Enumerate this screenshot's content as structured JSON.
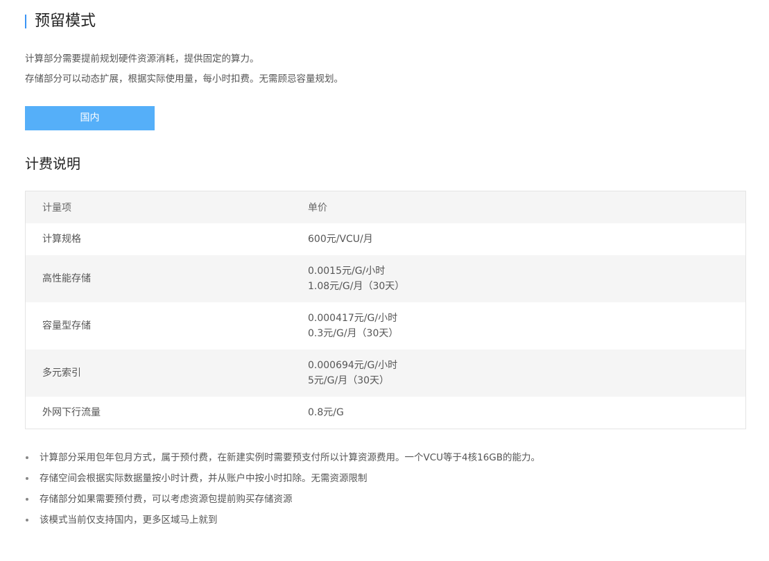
{
  "page": {
    "title": "预留模式",
    "intro": [
      "计算部分需要提前规划硬件资源消耗，提供固定的算力。",
      "存储部分可以动态扩展，根据实际使用量，每小时扣费。无需顾忌容量规划。"
    ],
    "region_tab": "国内",
    "billing_title": "计费说明"
  },
  "pricing_table": {
    "headers": [
      "计量项",
      "单价"
    ],
    "rows": [
      {
        "item": "计算规格",
        "price": [
          "600元/VCU/月"
        ]
      },
      {
        "item": "高性能存储",
        "price": [
          "0.0015元/G/小时",
          "1.08元/G/月（30天）"
        ]
      },
      {
        "item": "容量型存储",
        "price": [
          "0.000417元/G/小时",
          "0.3元/G/月（30天）"
        ]
      },
      {
        "item": "多元索引",
        "price": [
          "0.000694元/G/小时",
          "5元/G/月（30天）"
        ]
      },
      {
        "item": "外网下行流量",
        "price": [
          "0.8元/G"
        ]
      }
    ]
  },
  "notes": [
    "计算部分采用包年包月方式，属于预付费，在新建实例时需要预支付所以计算资源费用。一个VCU等于4核16GB的能力。",
    "存储空间会根据实际数据量按小时计费，并从账户中按小时扣除。无需资源限制",
    "存储部分如果需要预付费，可以考虑资源包提前购买存储资源",
    "该模式当前仅支持国内，更多区域马上就到"
  ],
  "colors": {
    "accent": "#3a94f5",
    "tab_background": "#55aff9",
    "row_stripe": "#f5f5f5"
  }
}
